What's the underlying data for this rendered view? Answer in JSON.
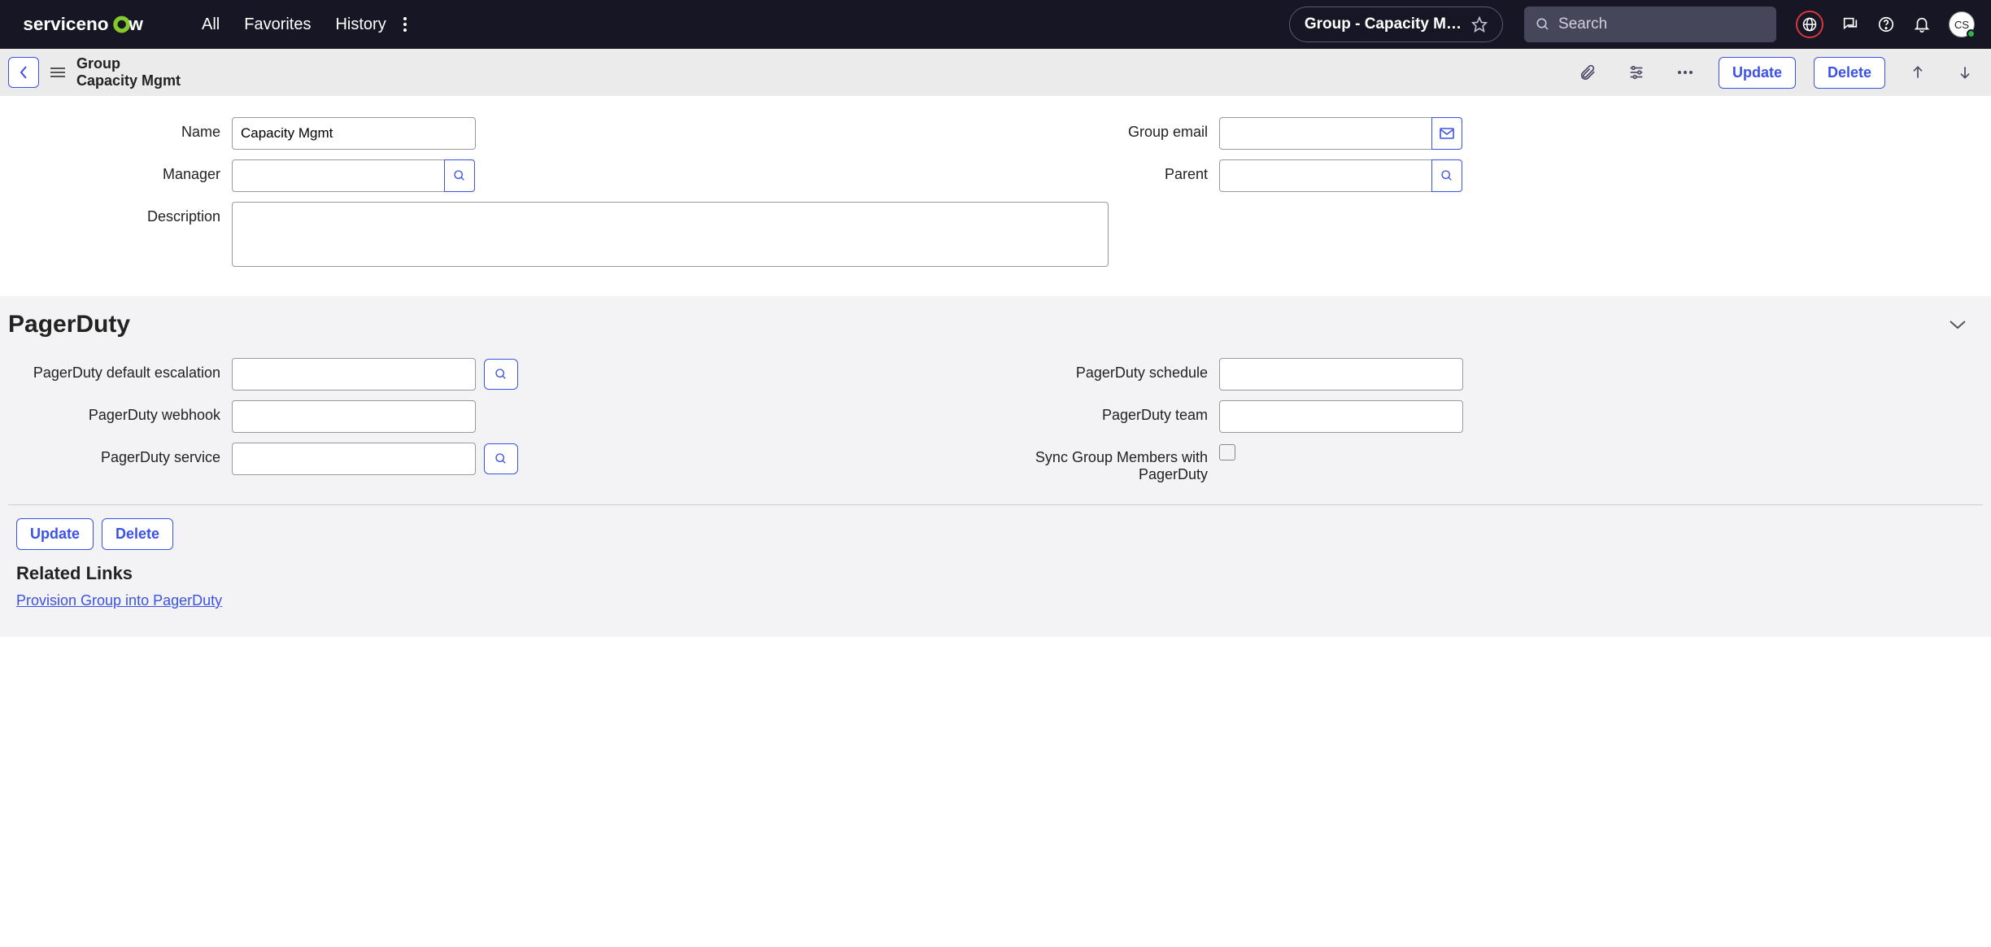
{
  "nav": {
    "all": "All",
    "favorites": "Favorites",
    "history": "History"
  },
  "header": {
    "breadcrumb": "Group - Capacity M…",
    "search_placeholder": "Search",
    "avatar": "CS"
  },
  "record": {
    "type": "Group",
    "title": "Capacity Mgmt",
    "update": "Update",
    "delete": "Delete"
  },
  "form": {
    "name_label": "Name",
    "name_value": "Capacity Mgmt",
    "manager_label": "Manager",
    "manager_value": "",
    "description_label": "Description",
    "description_value": "",
    "group_email_label": "Group email",
    "group_email_value": "",
    "parent_label": "Parent",
    "parent_value": ""
  },
  "section": {
    "title": "PagerDuty",
    "default_escalation_label": "PagerDuty default escalation",
    "default_escalation_value": "",
    "webhook_label": "PagerDuty webhook",
    "webhook_value": "",
    "service_label": "PagerDuty service",
    "service_value": "",
    "schedule_label": "PagerDuty schedule",
    "schedule_value": "",
    "team_label": "PagerDuty team",
    "team_value": "",
    "sync_label": "Sync Group Members with PagerDuty"
  },
  "footer": {
    "update": "Update",
    "delete": "Delete",
    "related_links": "Related Links",
    "provision_link": "Provision Group into PagerDuty"
  }
}
